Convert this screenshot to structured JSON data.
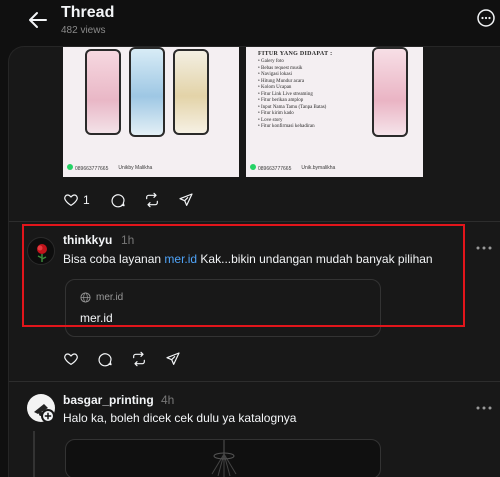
{
  "header": {
    "title": "Thread",
    "views": "482 views"
  },
  "post": {
    "promo_left_contact": "089663777665",
    "promo_left_shop": "Unikby Malikha",
    "promo_right_contact": "089663777665",
    "promo_right_shop": "Unik.bymalikha",
    "features_title": "FITUR YANG DIDAPAT :",
    "features": [
      "Galery foto",
      "Bebas request musik",
      "Navigasi lokasi",
      "Hitung Mundur acara",
      "Kolom Ucapan",
      "Fitur Link Live streaming",
      "Fitur berikan amplop",
      "Input Nama Tamu (Tanpa Batas)",
      "Fitur kirim kado",
      "Love story",
      "Fitur konfirmasi kehadiran"
    ],
    "like_count": "1"
  },
  "reply1": {
    "username": "thinkkyu",
    "time": "1h",
    "text_before": "Bisa coba layanan ",
    "link_text": "mer.id",
    "text_after": " Kak...bikin undangan mudah banyak pilihan",
    "card_domain": "mer.id",
    "card_title": "mer.id"
  },
  "reply2": {
    "username": "basgar_printing",
    "time": "4h",
    "text": "Halo ka, boleh dicek cek dulu ya katalognya"
  },
  "colors": {
    "background": "#101010",
    "panel": "#181818",
    "link": "#4fa3f7",
    "highlight_border": "#e2151b"
  }
}
